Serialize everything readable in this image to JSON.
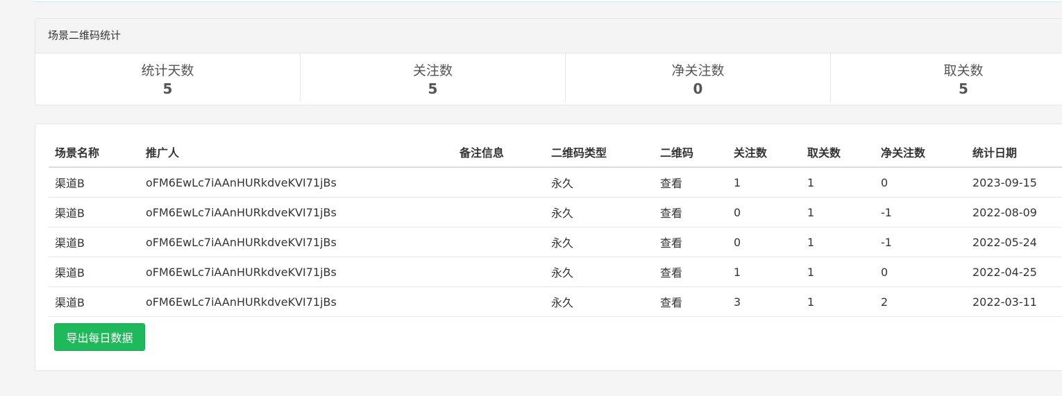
{
  "stats": {
    "title": "场景二维码统计",
    "items": [
      {
        "label": "统计天数",
        "value": "5"
      },
      {
        "label": "关注数",
        "value": "5"
      },
      {
        "label": "净关注数",
        "value": "0"
      },
      {
        "label": "取关数",
        "value": "5"
      }
    ]
  },
  "table": {
    "headers": [
      "场景名称",
      "推广人",
      "备注信息",
      "二维码类型",
      "二维码",
      "关注数",
      "取关数",
      "净关注数",
      "统计日期"
    ],
    "rows": [
      [
        "渠道B",
        "oFM6EwLc7iAAnHURkdveKVI71jBs",
        "",
        "永久",
        "查看",
        "1",
        "1",
        "0",
        "2023-09-15"
      ],
      [
        "渠道B",
        "oFM6EwLc7iAAnHURkdveKVI71jBs",
        "",
        "永久",
        "查看",
        "0",
        "1",
        "-1",
        "2022-08-09"
      ],
      [
        "渠道B",
        "oFM6EwLc7iAAnHURkdveKVI71jBs",
        "",
        "永久",
        "查看",
        "0",
        "1",
        "-1",
        "2022-05-24"
      ],
      [
        "渠道B",
        "oFM6EwLc7iAAnHURkdveKVI71jBs",
        "",
        "永久",
        "查看",
        "1",
        "1",
        "0",
        "2022-04-25"
      ],
      [
        "渠道B",
        "oFM6EwLc7iAAnHURkdveKVI71jBs",
        "",
        "永久",
        "查看",
        "3",
        "1",
        "2",
        "2022-03-11"
      ]
    ]
  },
  "export_button": "导出每日数据",
  "colors": {
    "accent_green": "#1fb85b",
    "panel_header_bg": "#f4f4f4"
  }
}
